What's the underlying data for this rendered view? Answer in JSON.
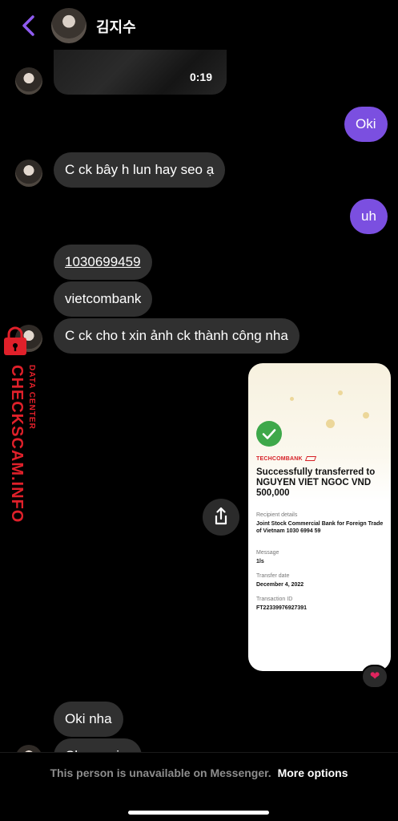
{
  "header": {
    "contact_name": "김지수"
  },
  "messages": {
    "video_duration": "0:19",
    "m1_out": "Oki",
    "m2_in": "C ck bây h lun hay seo ạ",
    "m3_out": "uh",
    "m4_in": "1030699459",
    "m5_in": "vietcombank",
    "m6_in": "C ck cho t xin ảnh ck thành công nha",
    "m7_in": "Oki nha",
    "m8_in_partial": "Ck ...r  ...ị..."
  },
  "receipt": {
    "brand": "TECHCOMBANK",
    "title": "Successfully transferred to NGUYEN VIET NGOC VND 500,000",
    "recipient_label": "Recipient details",
    "recipient_value": "Joint Stock Commercial Bank for Foreign Trade of Vietnam 1030 6994 59",
    "message_label": "Message",
    "message_value": "1ls",
    "date_label": "Transfer date",
    "date_value": "December 4, 2022",
    "txn_label": "Transaction ID",
    "txn_value": "FT22339976927391"
  },
  "reaction": "heart",
  "watermark": {
    "main": "CHECKSCAM.INFO",
    "sub": "DATA CENTER"
  },
  "footer": {
    "unavailable_text": "This person is unavailable on Messenger.",
    "more_options_label": "More options"
  },
  "colors": {
    "outgoing_bubble": "#7b4fe0",
    "incoming_bubble": "#303030",
    "back_arrow": "#8f5bf0",
    "watermark": "#e0202a"
  }
}
